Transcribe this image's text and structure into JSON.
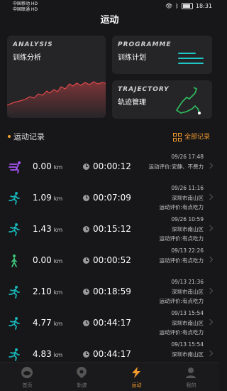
{
  "status_bar": {
    "carrier1": "中国移动 HD",
    "carrier2": "中国联通 HD",
    "time": "18:31"
  },
  "header": {
    "title": "运动"
  },
  "cards": {
    "analysis": {
      "en": "ANALYSIS",
      "cn": "训练分析"
    },
    "programme": {
      "en": "PROGRAMME",
      "cn": "训练计划"
    },
    "trajectory": {
      "en": "TRAJECTORY",
      "cn": "轨迹管理"
    }
  },
  "records": {
    "title": "运动记录",
    "all_label": "全部记录",
    "km_unit": "km",
    "items": [
      {
        "icon": "cycling-icon",
        "distance": "0.00",
        "duration": "00:00:12",
        "datetime": "09/26 17:48",
        "location": "",
        "comment": "运动评价:安静、不费力"
      },
      {
        "icon": "running-icon",
        "distance": "1.09",
        "duration": "00:07:09",
        "datetime": "09/26 11:16",
        "location": "深圳市南山区",
        "comment": "运动评价:有点吃力"
      },
      {
        "icon": "running-icon",
        "distance": "1.43",
        "duration": "00:15:12",
        "datetime": "09/26 10:59",
        "location": "深圳市南山区",
        "comment": "运动评价:有点吃力"
      },
      {
        "icon": "walking-icon",
        "distance": "0.00",
        "duration": "00:00:52",
        "datetime": "09/13 22:26",
        "location": "",
        "comment": "运动评价:有点吃力"
      },
      {
        "icon": "running-icon",
        "distance": "2.10",
        "duration": "00:18:59",
        "datetime": "09/13 21:36",
        "location": "深圳市南山区",
        "comment": "运动评价:有点吃力"
      },
      {
        "icon": "running-icon",
        "distance": "4.77",
        "duration": "00:44:17",
        "datetime": "09/13 15:54",
        "location": "深圳市南山区",
        "comment": "运动评价:有点吃力"
      },
      {
        "icon": "running-icon",
        "distance": "4.83",
        "duration": "00:44:17",
        "datetime": "09/13 15:54",
        "location": "深圳市南山区",
        "comment": ""
      }
    ]
  },
  "tabs": [
    {
      "label": "首页",
      "icon": "home-icon"
    },
    {
      "label": "轨迹",
      "icon": "location-pin-icon"
    },
    {
      "label": "运动",
      "icon": "lightning-icon"
    },
    {
      "label": "我的",
      "icon": "user-icon"
    }
  ],
  "colors": {
    "accent": "#f29a2e",
    "teal": "#1fc7c4",
    "chart_red": "#e2484a"
  }
}
